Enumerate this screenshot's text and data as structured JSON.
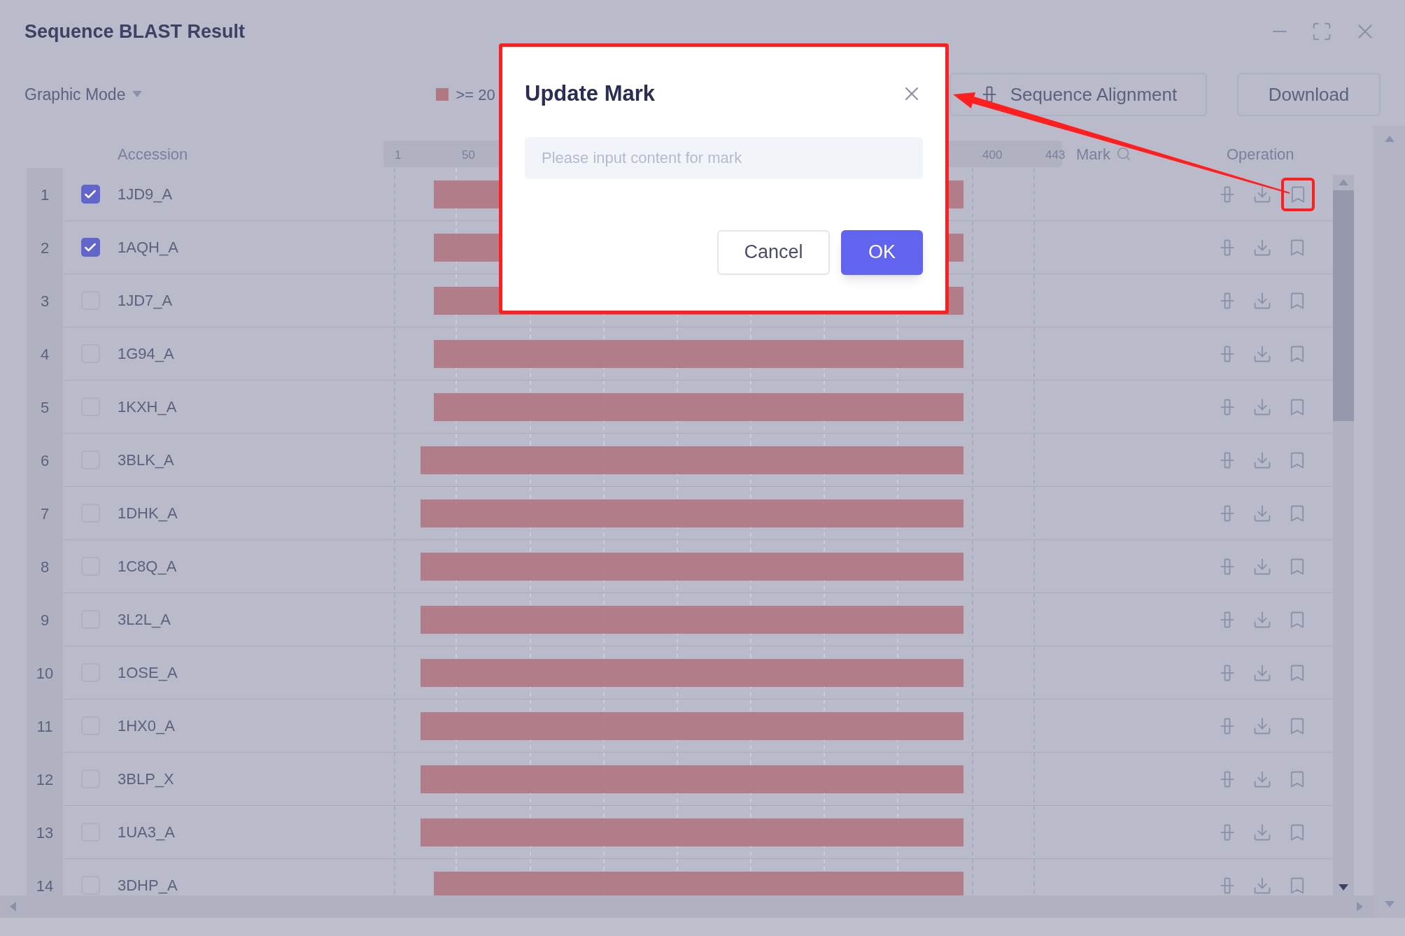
{
  "window": {
    "title": "Sequence BLAST Result"
  },
  "toolbar": {
    "mode_dropdown": "Graphic Mode",
    "legend": [
      {
        "label": ">= 20",
        "color": "#b07781"
      }
    ],
    "buttons": [
      "Sequence Alignment",
      "Download"
    ]
  },
  "table": {
    "columns": {
      "accession": "Accession",
      "mark": "Mark",
      "operation": "Operation"
    },
    "axis_ticks": [
      "1",
      "50",
      "400",
      "443"
    ],
    "rows": [
      {
        "number": "1",
        "accession": "1JD9_A",
        "checked": true,
        "kind": "short",
        "highlighted": true
      },
      {
        "number": "2",
        "accession": "1AQH_A",
        "checked": true,
        "kind": "short",
        "highlighted": false
      },
      {
        "number": "3",
        "accession": "1JD7_A",
        "checked": false,
        "kind": "short",
        "highlighted": false
      },
      {
        "number": "4",
        "accession": "1G94_A",
        "checked": false,
        "kind": "short",
        "highlighted": false
      },
      {
        "number": "5",
        "accession": "1KXH_A",
        "checked": false,
        "kind": "short",
        "highlighted": false
      },
      {
        "number": "6",
        "accession": "3BLK_A",
        "checked": false,
        "kind": "long",
        "highlighted": false
      },
      {
        "number": "7",
        "accession": "1DHK_A",
        "checked": false,
        "kind": "long",
        "highlighted": false
      },
      {
        "number": "8",
        "accession": "1C8Q_A",
        "checked": false,
        "kind": "long",
        "highlighted": false
      },
      {
        "number": "9",
        "accession": "3L2L_A",
        "checked": false,
        "kind": "long",
        "highlighted": false
      },
      {
        "number": "10",
        "accession": "1OSE_A",
        "checked": false,
        "kind": "long",
        "highlighted": false
      },
      {
        "number": "11",
        "accession": "1HX0_A",
        "checked": false,
        "kind": "long",
        "highlighted": false
      },
      {
        "number": "12",
        "accession": "3BLP_X",
        "checked": false,
        "kind": "long",
        "highlighted": false
      },
      {
        "number": "13",
        "accession": "1UA3_A",
        "checked": false,
        "kind": "long",
        "highlighted": false
      },
      {
        "number": "14",
        "accession": "3DHP_A",
        "checked": false,
        "kind": "short",
        "highlighted": false
      }
    ]
  },
  "dialog": {
    "title": "Update Mark",
    "placeholder": "Please input content for mark",
    "buttons": [
      "Cancel",
      "OK"
    ]
  }
}
